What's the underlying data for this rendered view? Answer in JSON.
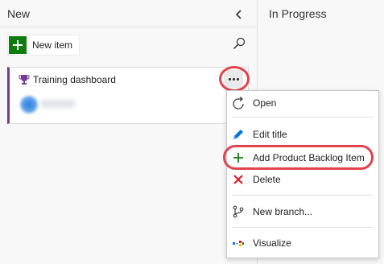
{
  "columns": {
    "new": {
      "title": "New"
    },
    "in_progress": {
      "title": "In Progress"
    }
  },
  "toolbar": {
    "new_item_label": "New item",
    "new_item_icon": "plus-icon",
    "search_icon": "search-icon",
    "collapse_icon": "chevron-left-icon"
  },
  "card": {
    "title": "Training dashboard",
    "icon": "trophy-icon",
    "type_color": "#773b93",
    "assignee": "blurred avatar and name"
  },
  "context_menu": {
    "items": [
      {
        "label": "Open",
        "icon": "open-arrow-icon"
      },
      {
        "label": "Edit title",
        "icon": "pencil-icon"
      },
      {
        "label": "Add Product Backlog Item",
        "icon": "plus-icon"
      },
      {
        "label": "Delete",
        "icon": "delete-x-icon"
      },
      {
        "label": "New branch...",
        "icon": "branch-icon"
      },
      {
        "label": "Visualize",
        "icon": "visualize-icon"
      }
    ]
  },
  "colors": {
    "accent_green": "#107c10",
    "highlight_red": "#e2434d",
    "pencil_blue": "#0078d4",
    "delete_red": "#e81123"
  }
}
